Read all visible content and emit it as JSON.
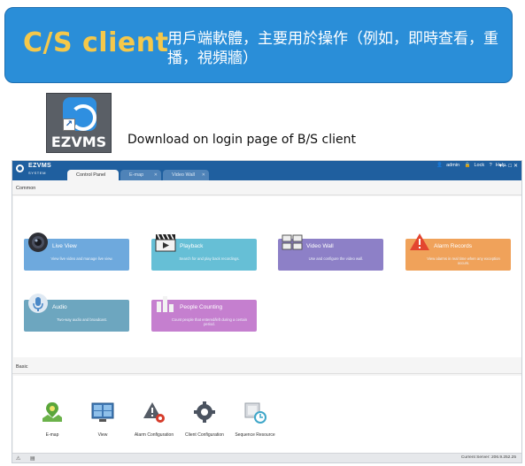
{
  "banner": {
    "title": "C/S client",
    "description": "用戶端軟體，主要用於操作（例如，即時查看，重播，視頻牆）",
    "background": "#2a8ed8",
    "title_color": "#f5c84a"
  },
  "app_icon": {
    "label": "EZVMS",
    "icon": "ezvms-shortcut-icon"
  },
  "download_note": "Download on login page of B/S client",
  "window": {
    "brand": {
      "name": "EZVMS",
      "subtitle": "SYSTEM"
    },
    "tabs": [
      {
        "label": "Control Panel",
        "active": true
      },
      {
        "label": "E-map",
        "active": false
      },
      {
        "label": "Video Wall",
        "active": false
      }
    ],
    "user": {
      "name": "admin",
      "lock": "Lock",
      "help": "Help"
    },
    "common_label": "Common",
    "basic_label": "Basic",
    "tiles": [
      {
        "name": "Live View",
        "desc": "View live video and manage live view.",
        "color": "#6ea9dd",
        "icon": "camera-icon"
      },
      {
        "name": "Playback",
        "desc": "Search for and play back recordings.",
        "color": "#66bfd6",
        "icon": "clapper-icon"
      },
      {
        "name": "Video Wall",
        "desc": "Use and configure the video wall.",
        "color": "#8d80c7",
        "icon": "video-wall-icon"
      },
      {
        "name": "Alarm Records",
        "desc": "View alarms in real time when any exception occurs.",
        "color": "#f0a25a",
        "icon": "alarm-icon"
      },
      {
        "name": "Audio",
        "desc": "Two-way audio and broadcast.",
        "color": "#6da6bf",
        "icon": "microphone-icon"
      },
      {
        "name": "People Counting",
        "desc": "Count people that entered/left during a certain period.",
        "color": "#c57fcf",
        "icon": "bar-chart-icon"
      }
    ],
    "basic_items": [
      {
        "label": "E-map",
        "icon": "map-pin-icon"
      },
      {
        "label": "View",
        "icon": "monitor-grid-icon"
      },
      {
        "label": "Alarm Configuration",
        "icon": "alarm-config-icon"
      },
      {
        "label": "Client Configuration",
        "icon": "gear-icon"
      },
      {
        "label": "Sequence Resource",
        "icon": "sequence-icon"
      }
    ],
    "status": {
      "server": "Current Server: 206.9.252.25"
    }
  }
}
